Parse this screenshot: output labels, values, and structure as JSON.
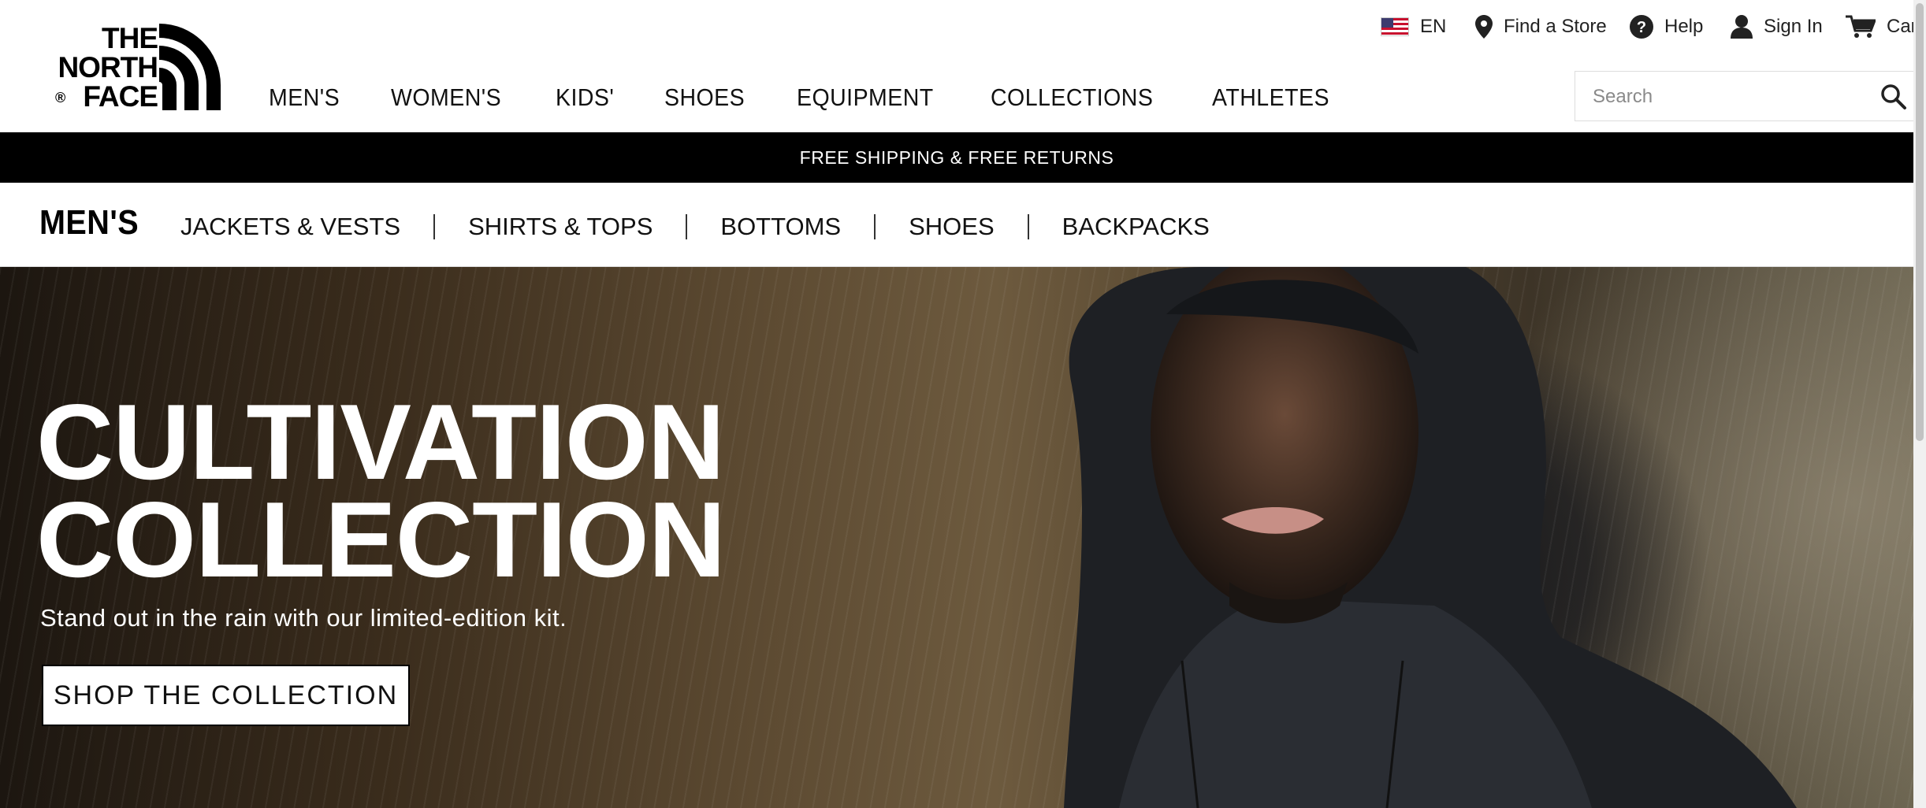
{
  "brand": {
    "logo_lines": [
      "THE",
      "NORTH",
      "FACE"
    ],
    "logo_registered": "®"
  },
  "utility_nav": {
    "language": "EN",
    "find_store": "Find a Store",
    "help": "Help",
    "sign_in": "Sign In",
    "cart": "Car"
  },
  "main_nav": {
    "items": [
      "MEN'S",
      "WOMEN'S",
      "KIDS'",
      "SHOES",
      "EQUIPMENT",
      "COLLECTIONS",
      "ATHLETES"
    ]
  },
  "search": {
    "placeholder": "Search",
    "value": ""
  },
  "promo_bar": {
    "text": "FREE SHIPPING & FREE RETURNS"
  },
  "sub_nav": {
    "title": "MEN'S",
    "links": [
      "JACKETS & VESTS",
      "SHIRTS & TOPS",
      "BOTTOMS",
      "SHOES",
      "BACKPACKS"
    ]
  },
  "hero": {
    "headline": "CULTIVATION\nCOLLECTION",
    "subheadline": "Stand out in the rain with our limited-edition kit.",
    "cta_label": "SHOP THE COLLECTION"
  },
  "icons": {
    "flag": "us-flag-icon",
    "store": "location-pin-icon",
    "help": "question-circle-icon",
    "account": "user-icon",
    "cart": "cart-icon",
    "search": "search-icon"
  },
  "colors": {
    "promo_background": "#000000",
    "text": "#111111",
    "hero_text": "#ffffff"
  }
}
